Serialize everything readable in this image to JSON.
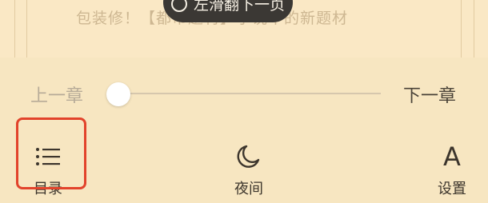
{
  "page": {
    "text": "包装修！【都市题材】小说中的新题材",
    "toast_text": "左滑翻下一页",
    "toast_icon": "info-circle-icon"
  },
  "slider": {
    "prev_chapter": "上一章",
    "next_chapter": "下一章",
    "progress": 0.0
  },
  "menu": {
    "toc": {
      "label": "目录",
      "icon": "list-icon"
    },
    "night": {
      "label": "夜间",
      "icon": "moon-icon"
    },
    "settings": {
      "label": "设置",
      "icon": "letter-a-icon",
      "icon_text": "A"
    }
  },
  "colors": {
    "background": "#f7e6c1",
    "highlight": "#e2432b",
    "toast_bg": "#3b3834"
  }
}
